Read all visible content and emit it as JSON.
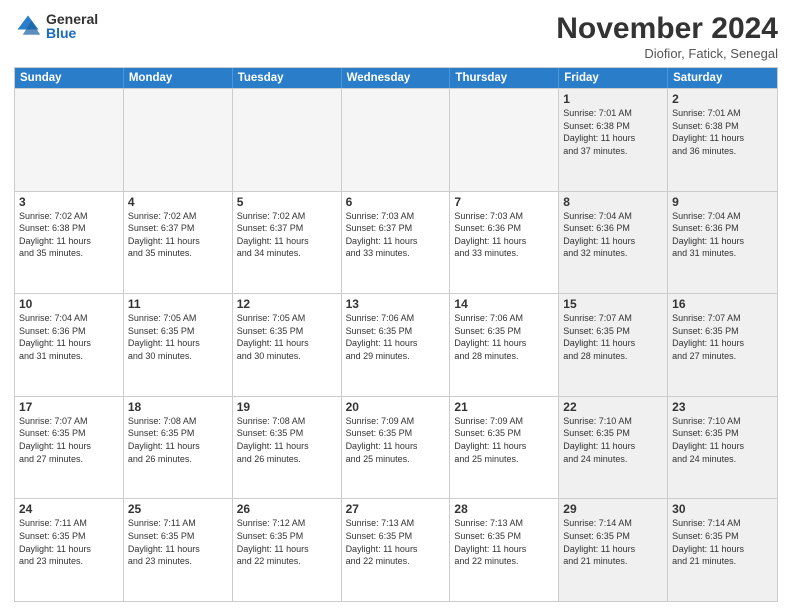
{
  "header": {
    "logo_general": "General",
    "logo_blue": "Blue",
    "month_title": "November 2024",
    "location": "Diofior, Fatick, Senegal"
  },
  "weekdays": [
    "Sunday",
    "Monday",
    "Tuesday",
    "Wednesday",
    "Thursday",
    "Friday",
    "Saturday"
  ],
  "rows": [
    [
      {
        "day": "",
        "info": "",
        "empty": true
      },
      {
        "day": "",
        "info": "",
        "empty": true
      },
      {
        "day": "",
        "info": "",
        "empty": true
      },
      {
        "day": "",
        "info": "",
        "empty": true
      },
      {
        "day": "",
        "info": "",
        "empty": true
      },
      {
        "day": "1",
        "info": "Sunrise: 7:01 AM\nSunset: 6:38 PM\nDaylight: 11 hours\nand 37 minutes.",
        "empty": false
      },
      {
        "day": "2",
        "info": "Sunrise: 7:01 AM\nSunset: 6:38 PM\nDaylight: 11 hours\nand 36 minutes.",
        "empty": false
      }
    ],
    [
      {
        "day": "3",
        "info": "Sunrise: 7:02 AM\nSunset: 6:38 PM\nDaylight: 11 hours\nand 35 minutes.",
        "empty": false
      },
      {
        "day": "4",
        "info": "Sunrise: 7:02 AM\nSunset: 6:37 PM\nDaylight: 11 hours\nand 35 minutes.",
        "empty": false
      },
      {
        "day": "5",
        "info": "Sunrise: 7:02 AM\nSunset: 6:37 PM\nDaylight: 11 hours\nand 34 minutes.",
        "empty": false
      },
      {
        "day": "6",
        "info": "Sunrise: 7:03 AM\nSunset: 6:37 PM\nDaylight: 11 hours\nand 33 minutes.",
        "empty": false
      },
      {
        "day": "7",
        "info": "Sunrise: 7:03 AM\nSunset: 6:36 PM\nDaylight: 11 hours\nand 33 minutes.",
        "empty": false
      },
      {
        "day": "8",
        "info": "Sunrise: 7:04 AM\nSunset: 6:36 PM\nDaylight: 11 hours\nand 32 minutes.",
        "empty": false
      },
      {
        "day": "9",
        "info": "Sunrise: 7:04 AM\nSunset: 6:36 PM\nDaylight: 11 hours\nand 31 minutes.",
        "empty": false
      }
    ],
    [
      {
        "day": "10",
        "info": "Sunrise: 7:04 AM\nSunset: 6:36 PM\nDaylight: 11 hours\nand 31 minutes.",
        "empty": false
      },
      {
        "day": "11",
        "info": "Sunrise: 7:05 AM\nSunset: 6:35 PM\nDaylight: 11 hours\nand 30 minutes.",
        "empty": false
      },
      {
        "day": "12",
        "info": "Sunrise: 7:05 AM\nSunset: 6:35 PM\nDaylight: 11 hours\nand 30 minutes.",
        "empty": false
      },
      {
        "day": "13",
        "info": "Sunrise: 7:06 AM\nSunset: 6:35 PM\nDaylight: 11 hours\nand 29 minutes.",
        "empty": false
      },
      {
        "day": "14",
        "info": "Sunrise: 7:06 AM\nSunset: 6:35 PM\nDaylight: 11 hours\nand 28 minutes.",
        "empty": false
      },
      {
        "day": "15",
        "info": "Sunrise: 7:07 AM\nSunset: 6:35 PM\nDaylight: 11 hours\nand 28 minutes.",
        "empty": false
      },
      {
        "day": "16",
        "info": "Sunrise: 7:07 AM\nSunset: 6:35 PM\nDaylight: 11 hours\nand 27 minutes.",
        "empty": false
      }
    ],
    [
      {
        "day": "17",
        "info": "Sunrise: 7:07 AM\nSunset: 6:35 PM\nDaylight: 11 hours\nand 27 minutes.",
        "empty": false
      },
      {
        "day": "18",
        "info": "Sunrise: 7:08 AM\nSunset: 6:35 PM\nDaylight: 11 hours\nand 26 minutes.",
        "empty": false
      },
      {
        "day": "19",
        "info": "Sunrise: 7:08 AM\nSunset: 6:35 PM\nDaylight: 11 hours\nand 26 minutes.",
        "empty": false
      },
      {
        "day": "20",
        "info": "Sunrise: 7:09 AM\nSunset: 6:35 PM\nDaylight: 11 hours\nand 25 minutes.",
        "empty": false
      },
      {
        "day": "21",
        "info": "Sunrise: 7:09 AM\nSunset: 6:35 PM\nDaylight: 11 hours\nand 25 minutes.",
        "empty": false
      },
      {
        "day": "22",
        "info": "Sunrise: 7:10 AM\nSunset: 6:35 PM\nDaylight: 11 hours\nand 24 minutes.",
        "empty": false
      },
      {
        "day": "23",
        "info": "Sunrise: 7:10 AM\nSunset: 6:35 PM\nDaylight: 11 hours\nand 24 minutes.",
        "empty": false
      }
    ],
    [
      {
        "day": "24",
        "info": "Sunrise: 7:11 AM\nSunset: 6:35 PM\nDaylight: 11 hours\nand 23 minutes.",
        "empty": false
      },
      {
        "day": "25",
        "info": "Sunrise: 7:11 AM\nSunset: 6:35 PM\nDaylight: 11 hours\nand 23 minutes.",
        "empty": false
      },
      {
        "day": "26",
        "info": "Sunrise: 7:12 AM\nSunset: 6:35 PM\nDaylight: 11 hours\nand 22 minutes.",
        "empty": false
      },
      {
        "day": "27",
        "info": "Sunrise: 7:13 AM\nSunset: 6:35 PM\nDaylight: 11 hours\nand 22 minutes.",
        "empty": false
      },
      {
        "day": "28",
        "info": "Sunrise: 7:13 AM\nSunset: 6:35 PM\nDaylight: 11 hours\nand 22 minutes.",
        "empty": false
      },
      {
        "day": "29",
        "info": "Sunrise: 7:14 AM\nSunset: 6:35 PM\nDaylight: 11 hours\nand 21 minutes.",
        "empty": false
      },
      {
        "day": "30",
        "info": "Sunrise: 7:14 AM\nSunset: 6:35 PM\nDaylight: 11 hours\nand 21 minutes.",
        "empty": false
      }
    ]
  ]
}
